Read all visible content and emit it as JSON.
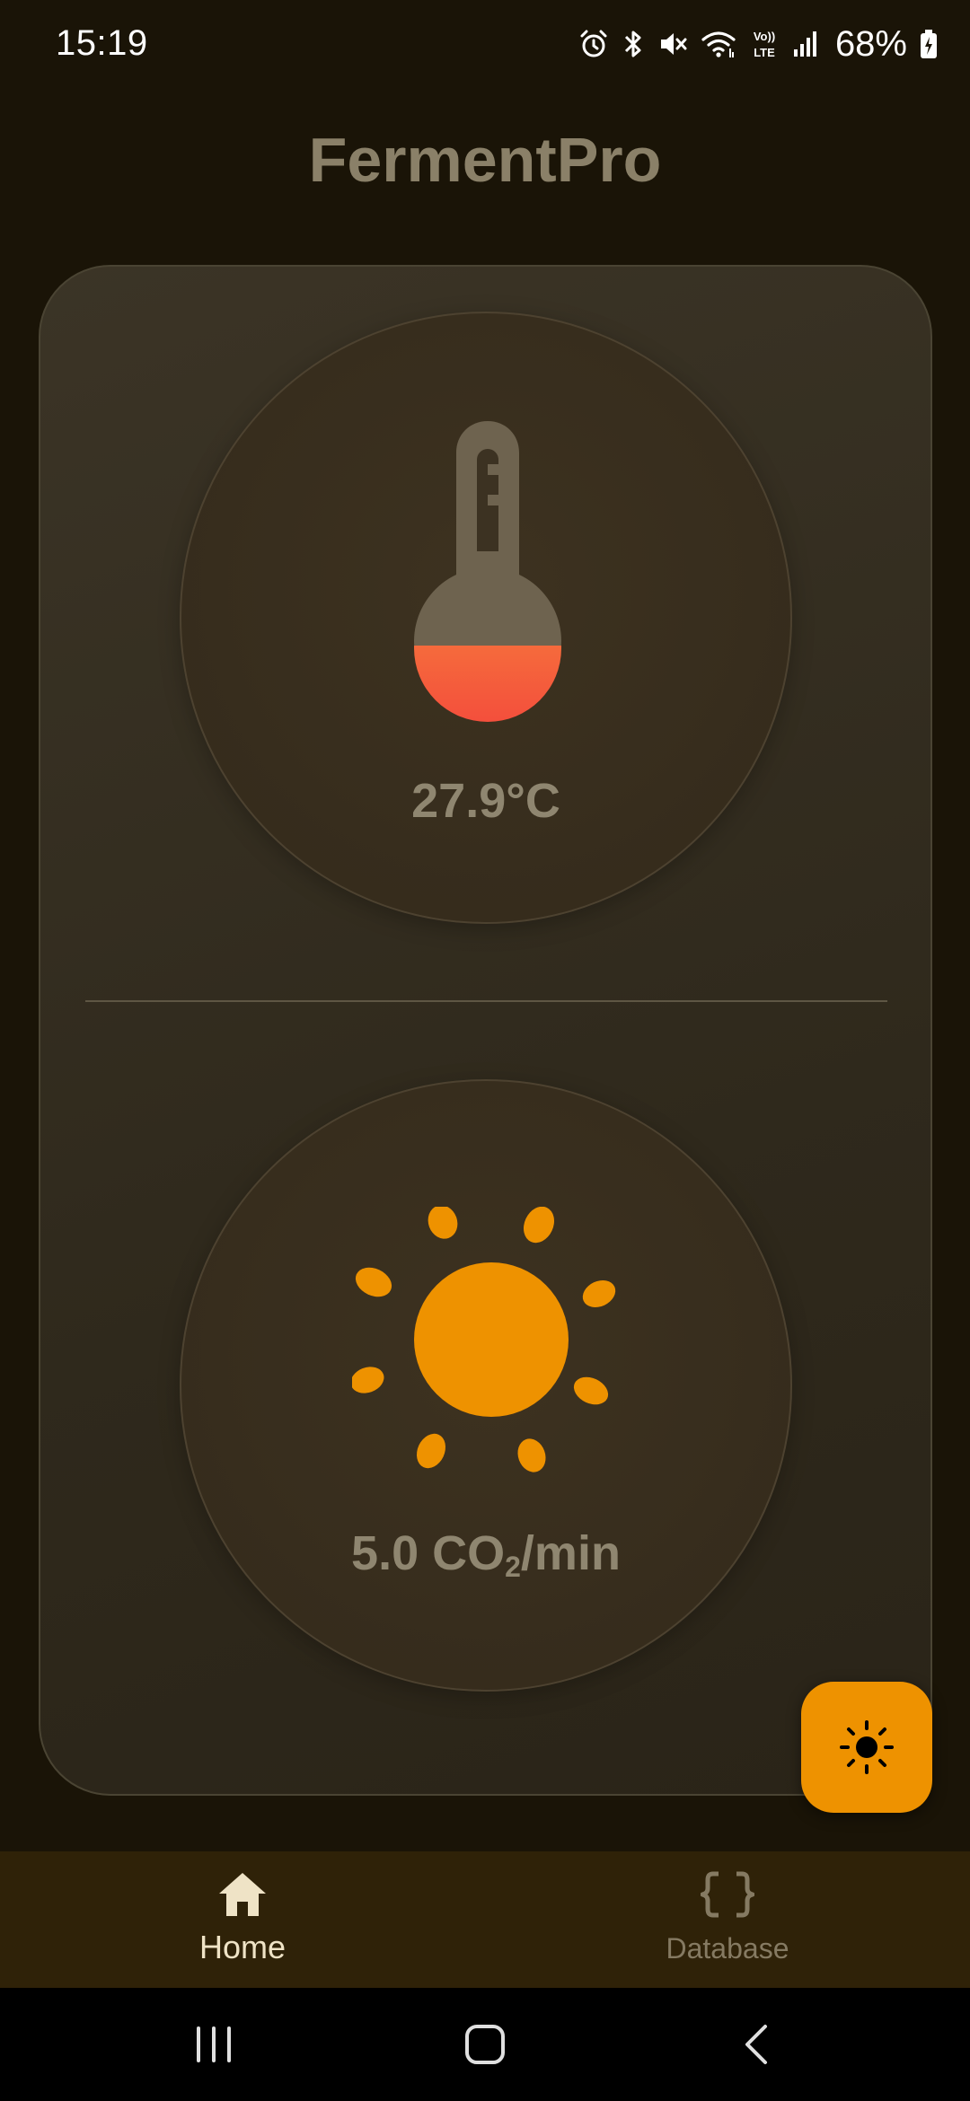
{
  "status_bar": {
    "time": "15:19",
    "battery": "68%",
    "icons": [
      "alarm-icon",
      "bluetooth-icon",
      "mute-icon",
      "wifi-icon",
      "volte-icon",
      "signal-icon",
      "battery-charging-icon"
    ]
  },
  "app": {
    "title": "FermentPro"
  },
  "temperature": {
    "value": "27.9°C",
    "icon": "thermometer-icon"
  },
  "co2": {
    "value_prefix": "5.0 CO",
    "value_sub": "2",
    "value_suffix": "/min",
    "icon": "sun-icon"
  },
  "fab": {
    "icon": "brightness-icon"
  },
  "bottom_nav": {
    "items": [
      {
        "label": "Home",
        "icon": "home-icon",
        "active": true
      },
      {
        "label": "Database",
        "icon": "braces-icon",
        "active": false
      }
    ]
  },
  "colors": {
    "background": "#1a1407",
    "accent": "#ee9200",
    "thermo_fill": "#f4553a",
    "nav_background": "#2f2208"
  }
}
